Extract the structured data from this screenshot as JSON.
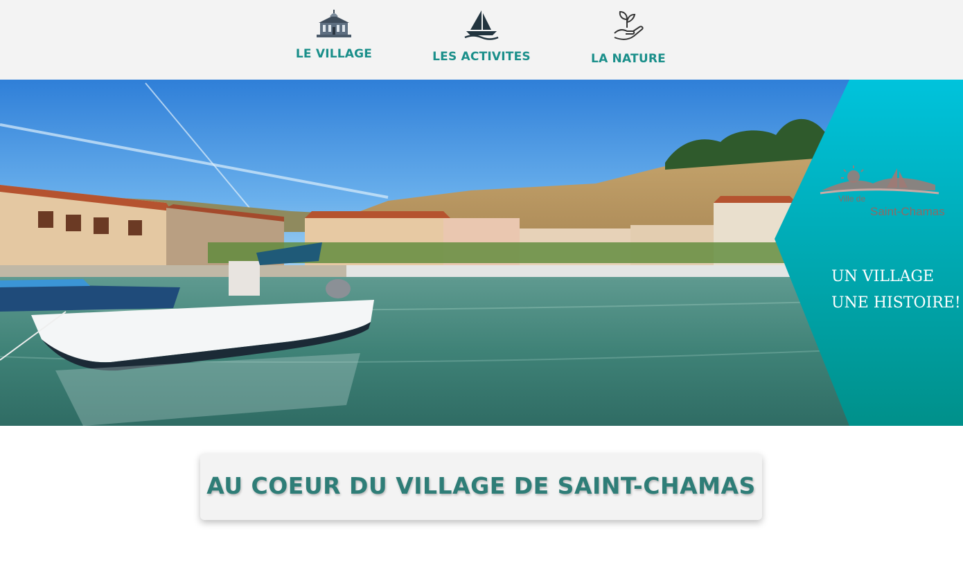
{
  "nav": {
    "items": [
      {
        "label": "LE VILLAGE",
        "icon": "town-hall-icon"
      },
      {
        "label": "LES ACTIVITES",
        "icon": "sailboat-icon"
      },
      {
        "label": "LA NATURE",
        "icon": "hand-plant-icon"
      }
    ]
  },
  "hero": {
    "logo": {
      "line1": "Ville de",
      "line2": "Saint-Chamas"
    },
    "title_line1": "UN VILLAGE",
    "title_line2": "UNE HISTOIRE!"
  },
  "main": {
    "heading": "AU COEUR DU VILLAGE DE SAINT-CHAMAS"
  },
  "colors": {
    "accent": "#1a8f8a",
    "heading": "#2e7d77",
    "panel": "#00a9b7",
    "nav_bg": "#f3f3f3"
  }
}
